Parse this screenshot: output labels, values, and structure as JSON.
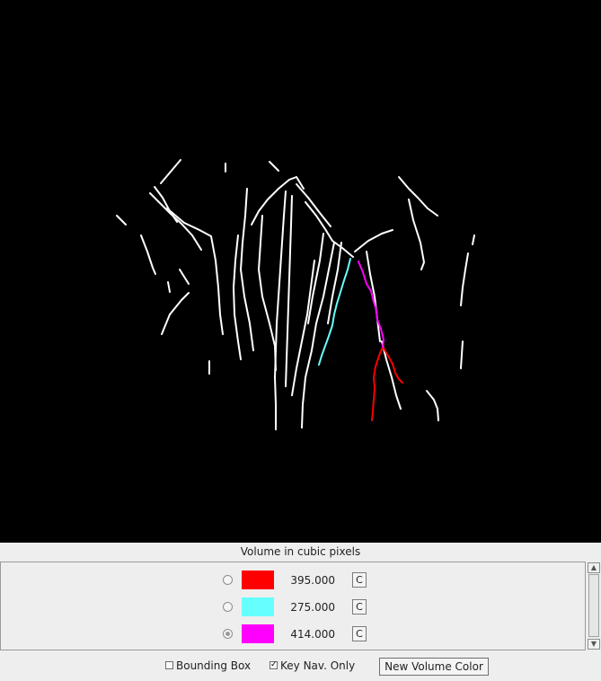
{
  "panel": {
    "header": "Volume in cubic pixels"
  },
  "volumes": [
    {
      "color": "#ff0000",
      "value": "395.000",
      "button": "C",
      "selected": false
    },
    {
      "color": "#66ffff",
      "value": "275.000",
      "button": "C",
      "selected": false
    },
    {
      "color": "#ff00ff",
      "value": "414.000",
      "button": "C",
      "selected": true
    }
  ],
  "controls": {
    "bounding_box_label": "Bounding Box",
    "bounding_box_checked": false,
    "key_nav_label": "Key Nav. Only",
    "key_nav_checked": true,
    "new_volume_color_label": "New Volume Color"
  },
  "colors": {
    "background": "#000000",
    "structure": "#ffffff",
    "trace_red": "#ff0000",
    "trace_cyan": "#66ffff",
    "trace_magenta": "#ff00ff"
  }
}
